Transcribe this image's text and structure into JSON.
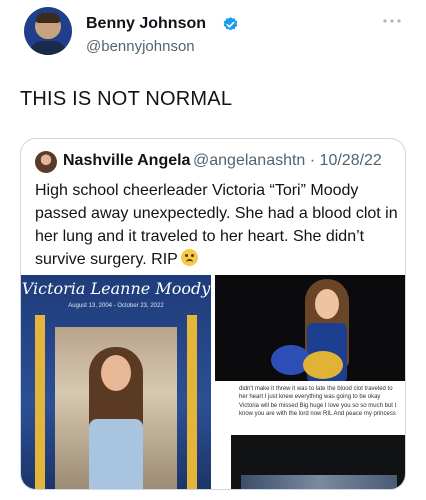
{
  "author": {
    "display_name": "Benny Johnson",
    "handle": "@bennyjohnson",
    "verified": true,
    "avatar_icon": "profile-photo"
  },
  "tweet": {
    "text": "THIS IS NOT NORMAL"
  },
  "quoted_tweet": {
    "display_name": "Nashville Angela",
    "handle_and_date": "@angelanashtn · 10/28/22",
    "text": "High school cheerleader Victoria “Tori” Moody passed away unexpectedly. She had a blood clot in her lung and  it traveled to her heart. She didn’t survive surgery. RIP",
    "emoji": "crying-face-icon",
    "media": {
      "memorial_name": "Victoria Leanne Moody",
      "memorial_dates": "August 13, 2004 - October 23, 2022",
      "note_text": "didn't make it threw it was to late the blood clot traveled to her heart I just knew everything was going to be okay Victoria will be missed Big huge I love you so so much but I know you are with the lord now RIL And peace my princess"
    }
  },
  "colors": {
    "verified_blue": "#1d9bf0",
    "handle_gray": "#536471",
    "border": "#cfd9de"
  }
}
